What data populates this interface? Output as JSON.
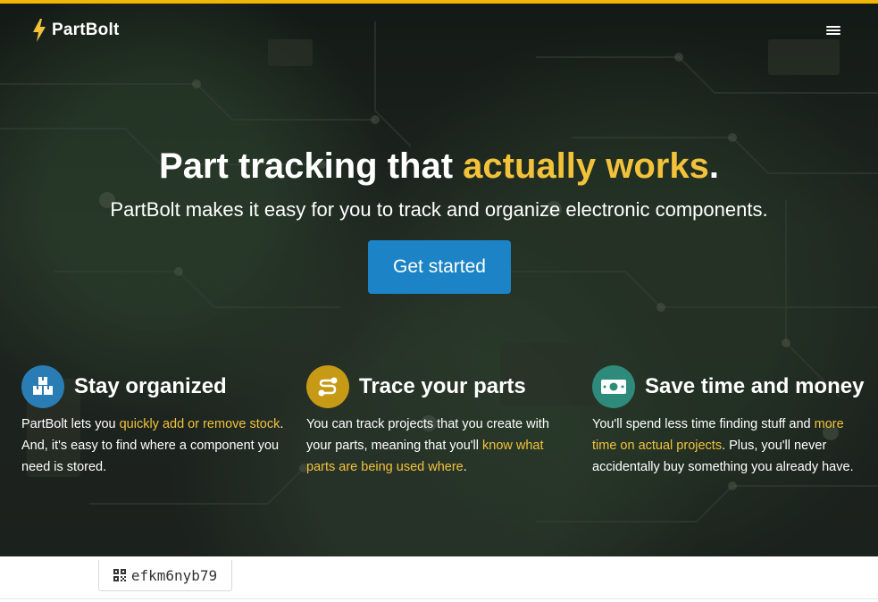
{
  "header": {
    "brand": "PartBolt",
    "menu_icon": "hamburger-menu-icon"
  },
  "hero": {
    "headline_start": "Part tracking that ",
    "headline_accent": "actually works",
    "headline_end": ".",
    "subheadline": "PartBolt makes it easy for you to track and organize electronic components.",
    "cta_label": "Get started"
  },
  "features": [
    {
      "title": "Stay organized",
      "icon": "boxes-icon",
      "icon_bg": "#2a7db4",
      "text_before": "PartBolt lets you ",
      "link": "quickly add or remove stock",
      "text_after": ". And, it's easy to find where a component you need is stored."
    },
    {
      "title": "Trace your parts",
      "icon": "route-icon",
      "icon_bg": "#c79a16",
      "text_before": "You can track projects that you create with your parts, meaning that you'll ",
      "link": "know what parts are being used where",
      "text_after": "."
    },
    {
      "title": "Save time and money",
      "icon": "money-bill-icon",
      "icon_bg": "#2e8a7a",
      "text_before": "You'll spend less time finding stuff and ",
      "link": "more time on actual projects",
      "text_after": ". Plus, you'll never accidentally buy something you already have."
    }
  ],
  "code_chip": {
    "icon": "qr-code-icon",
    "code": "efkm6nyb79"
  },
  "colors": {
    "accent": "#f2c23a",
    "primary": "#1c84c6",
    "top_bar": "#f2b705"
  }
}
